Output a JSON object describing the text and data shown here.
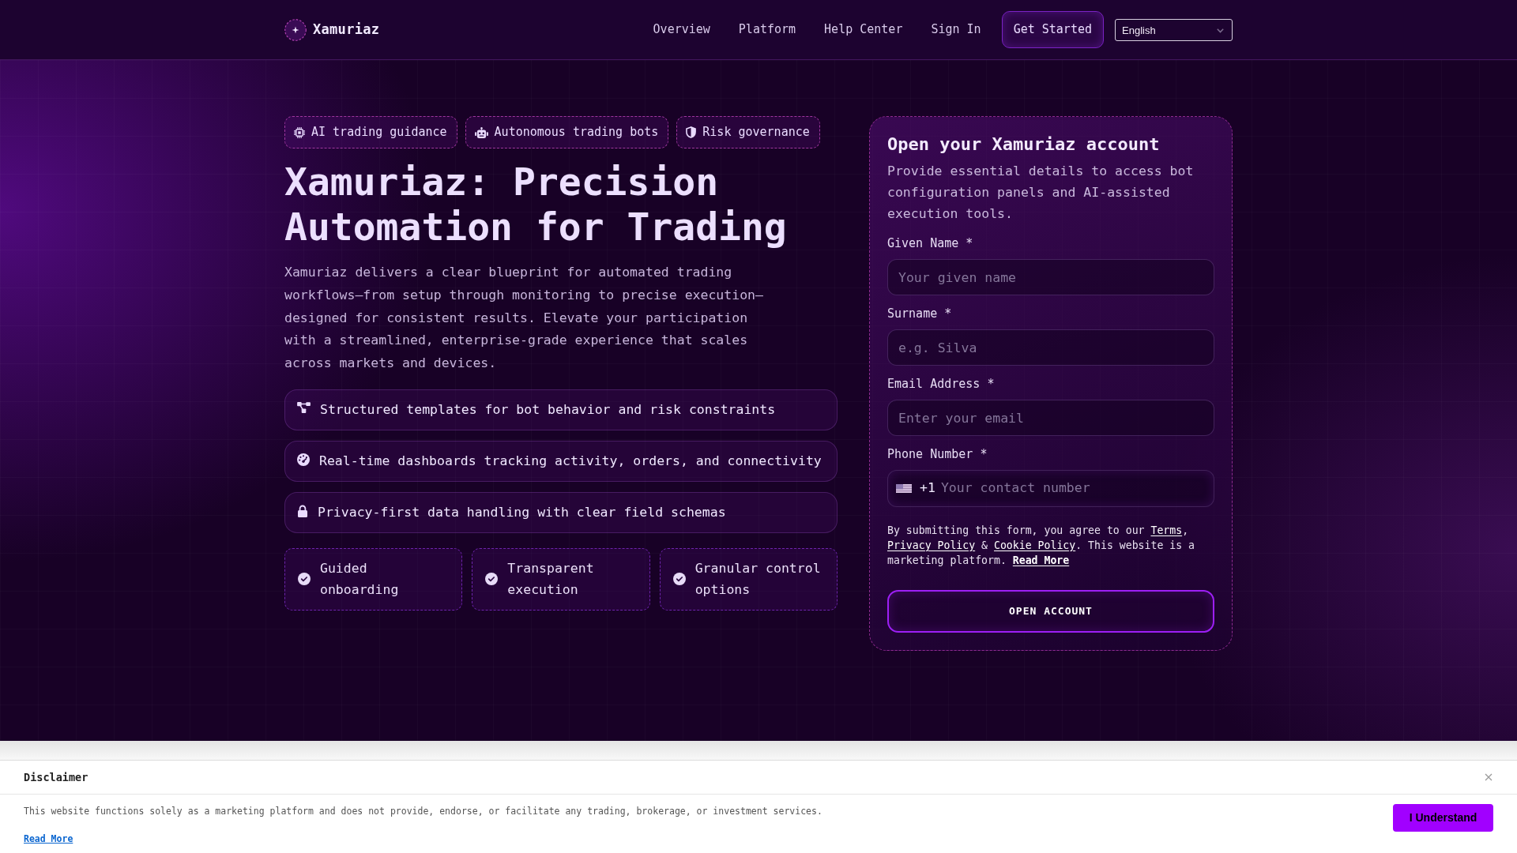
{
  "navbar": {
    "brand": "Xamuriaz",
    "links": [
      "Overview",
      "Platform",
      "Help Center",
      "Sign In"
    ],
    "cta": "Get Started",
    "language": "English"
  },
  "hero": {
    "badges": [
      "AI trading guidance",
      "Autonomous trading bots",
      "Risk governance"
    ],
    "title": "Xamuriaz: Precision Automation for Trading",
    "description": "Xamuriaz delivers a clear blueprint for automated trading workflows—from setup through monitoring to precise execution—designed for consistent results. Elevate your participation with a streamlined, enterprise-grade experience that scales across markets and devices.",
    "features": [
      "Structured templates for bot behavior and risk constraints",
      "Real-time dashboards tracking activity, orders, and connectivity",
      "Privacy-first data handling with clear field schemas"
    ],
    "highlights": [
      "Guided onboarding",
      "Transparent execution",
      "Granular control options"
    ]
  },
  "signup": {
    "title": "Open your Xamuriaz account",
    "subtitle": "Provide essential details to access bot configuration panels and AI-assisted execution tools.",
    "fields": [
      {
        "kind": "text",
        "label": "Given Name *",
        "placeholder": "Your given name"
      },
      {
        "kind": "text",
        "label": "Surname *",
        "placeholder": "e.g. Silva"
      },
      {
        "kind": "text",
        "label": "Email Address *",
        "placeholder": "Enter your email"
      },
      {
        "kind": "phone",
        "label": "Phone Number *",
        "dial_code": "+1",
        "placeholder": "Your contact number"
      }
    ],
    "consent": [
      {
        "kind": "text",
        "text": "By submitting this form, you agree to our "
      },
      {
        "kind": "link",
        "text": "Terms"
      },
      {
        "kind": "text",
        "text": ", "
      },
      {
        "kind": "link",
        "text": "Privacy Policy"
      },
      {
        "kind": "text",
        "text": " & "
      },
      {
        "kind": "link",
        "text": "Cookie Policy"
      },
      {
        "kind": "text",
        "text": ". This website is a marketing platform. "
      },
      {
        "kind": "bold_link",
        "text": "Read More"
      }
    ],
    "submit": "OPEN ACCOUNT"
  },
  "disclaimer": {
    "title": "Disclaimer",
    "text": "This website functions solely as a marketing platform and does not provide, endorse, or facilitate any trading, brokerage, or investment services.",
    "link": "Read More",
    "button": "I Understand"
  }
}
